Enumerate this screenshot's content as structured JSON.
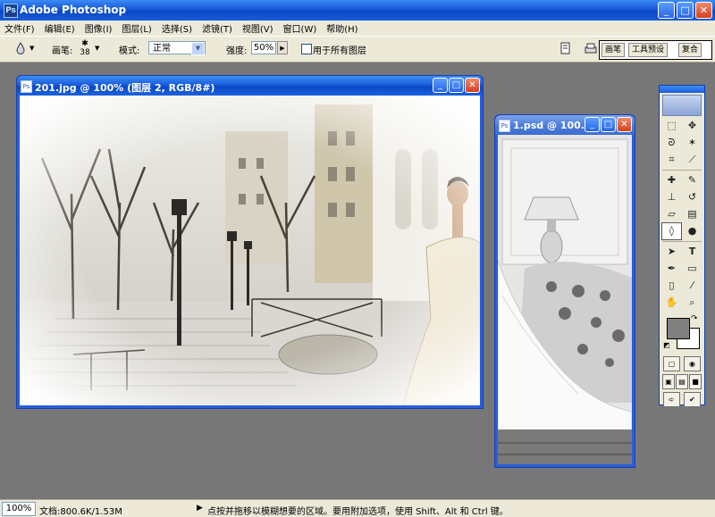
{
  "app": {
    "title": "Adobe Photoshop",
    "icon": "Ps"
  },
  "window_buttons": {
    "minimize": "_",
    "maximize": "□",
    "close": "✕"
  },
  "menu": [
    "文件(F)",
    "编辑(E)",
    "图像(I)",
    "图层(L)",
    "选择(S)",
    "滤镜(T)",
    "视图(V)",
    "窗口(W)",
    "帮助(H)"
  ],
  "options": {
    "brush_label": "画笔:",
    "brush_size": "38",
    "mode_label": "模式:",
    "mode_value": "正常",
    "strength_label": "强度:",
    "strength_value": "50%",
    "sample_all_label": "用于所有图层",
    "sample_all_checked": false,
    "palette_tabs": [
      "画笔",
      "工具预设",
      "复合"
    ]
  },
  "documents": [
    {
      "title": "201.jpg @ 100% (图层 2, RGB/8#)",
      "active": true
    },
    {
      "title": "1.psd @ 100...",
      "active": false
    }
  ],
  "toolbox": {
    "foreground_color": "#808080",
    "background_color": "#ffffff",
    "tools": [
      "marquee",
      "move",
      "lasso",
      "magic-wand",
      "crop",
      "slice",
      "healing",
      "brush",
      "stamp",
      "history-brush",
      "eraser",
      "gradient",
      "blur",
      "dodge",
      "path-select",
      "type",
      "pen",
      "shape",
      "notes",
      "eyedropper",
      "hand",
      "zoom"
    ],
    "active_tool": "blur"
  },
  "status": {
    "zoom": "100%",
    "doc_info": "文档:800.6K/1.53M",
    "hint": "点按并拖移以模糊想要的区域。要用附加选项，使用 Shift、Alt 和 Ctrl 键。"
  }
}
